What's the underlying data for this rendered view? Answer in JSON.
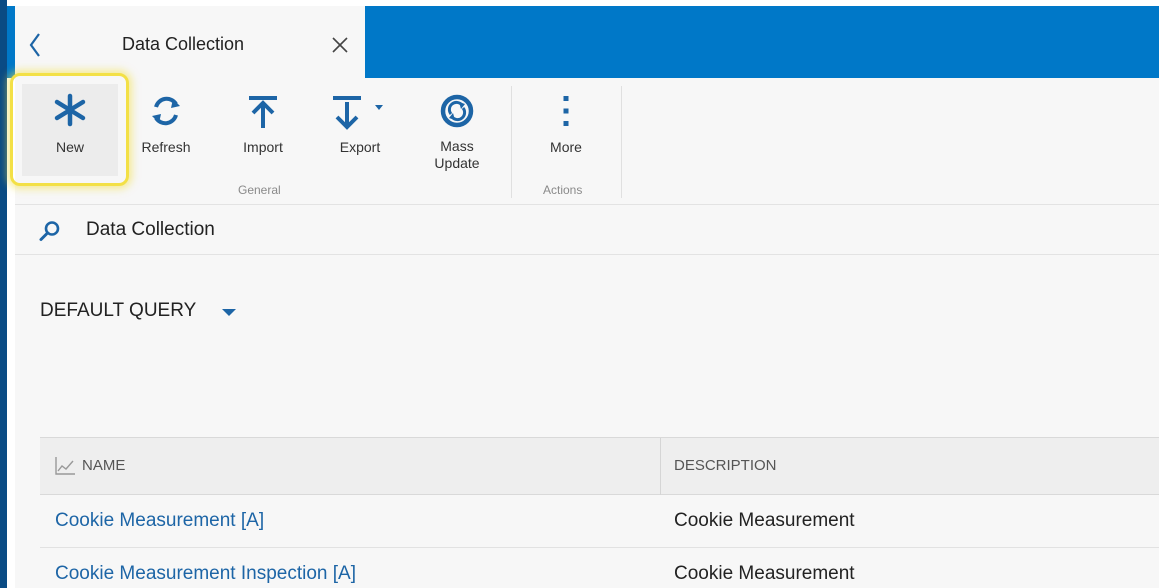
{
  "tab": {
    "title": "Data Collection",
    "back_icon": "chevron-left-icon",
    "close_icon": "close-icon"
  },
  "ribbon": {
    "buttons": [
      {
        "label": "New",
        "icon": "asterisk-icon"
      },
      {
        "label": "Refresh",
        "icon": "refresh-icon"
      },
      {
        "label": "Import",
        "icon": "import-icon"
      },
      {
        "label": "Export",
        "icon": "export-icon"
      },
      {
        "label": "Mass",
        "label2": "Update",
        "icon": "mass-update-icon"
      },
      {
        "label": "More",
        "icon": "more-vertical-icon"
      }
    ],
    "groups": [
      "General",
      "Actions"
    ]
  },
  "search": {
    "text": "Data Collection",
    "icon": "search-icon"
  },
  "query": {
    "label": "DEFAULT QUERY",
    "icon": "caret-down-icon"
  },
  "grid": {
    "columns": [
      "NAME",
      "DESCRIPTION"
    ],
    "rows": [
      {
        "name": "Cookie Measurement [A]",
        "description": "Cookie Measurement"
      },
      {
        "name": "Cookie Measurement Inspection [A]",
        "description": "Cookie Measurement"
      }
    ]
  },
  "colors": {
    "header_blue": "#0078c8",
    "icon_blue": "#1d65a6",
    "highlight_yellow": "#f3e046",
    "link_blue": "#1d65a6"
  }
}
